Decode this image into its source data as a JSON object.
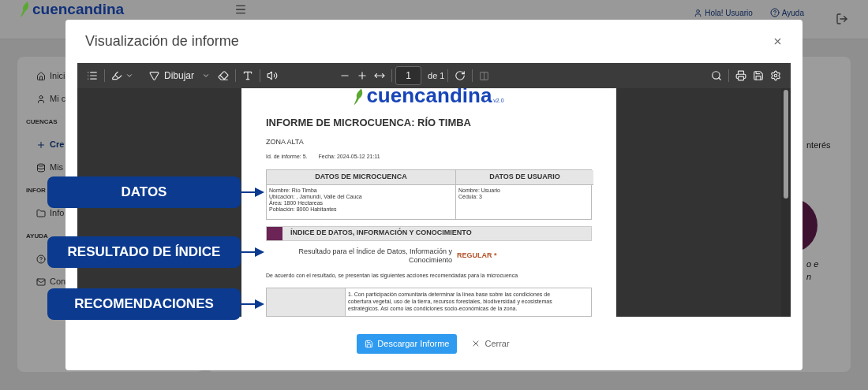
{
  "app_header": {
    "logo": "cuencandina",
    "user": "Hola! Usuario",
    "help": "Ayuda"
  },
  "sidebar": {
    "items": [
      {
        "kind": "item",
        "label": "Inici"
      },
      {
        "kind": "item",
        "label": "Mi c"
      },
      {
        "kind": "section",
        "label": "CUENCAS"
      },
      {
        "kind": "link",
        "label": "Cre"
      },
      {
        "kind": "item",
        "label": "Mis"
      },
      {
        "kind": "section",
        "label": "INFOR"
      },
      {
        "kind": "item",
        "label": "Info"
      },
      {
        "kind": "section",
        "label": "AYUDA"
      },
      {
        "kind": "item"
      },
      {
        "kind": "item",
        "label": "Con"
      }
    ]
  },
  "background_fragments": {
    "interest": "nterés",
    "line_1": "o e",
    "line_2": "n"
  },
  "modal": {
    "title": "Visualización de informe",
    "viewer": {
      "draw_label": "Dibujar",
      "page": "1",
      "page_total": "de 1",
      "two_page_disabled": true
    },
    "document": {
      "logo": "cuencandina",
      "version": "v2.0",
      "title": "INFORME DE MICROCUENCA: RÍO TIMBA",
      "zone": "ZONA ALTA",
      "report_id": "Id. de informe: 5.",
      "date": "Fecha: 2024-05-12  21:11",
      "table": {
        "columns": [
          "DATOS DE MICROCUENCA",
          "DATOS DE USUARIO"
        ],
        "cells": [
          [
            "Nombre: Río Timba",
            "Ubicación: , Jamundí, Valle del Cauca",
            "Área: 1800 Hectareas",
            "Población: 8000 Habitantes"
          ],
          [
            "Nombre: Usuario",
            "Cédula: 3"
          ]
        ]
      },
      "index_section": {
        "title": "ÍNDICE DE DATOS, INFORMACIÓN Y CONOCIMIENTO",
        "color": "#6b2455",
        "result_label_1": "Resultado para el Índice de Datos, Información y",
        "result_label_2": "Conocimiento",
        "result": "REGULAR *"
      },
      "intro": "De acuerdo con el resultado, se presentan las siguientes acciones recomendadas para la microcuenca",
      "recommendation_lines": [
        "1. Con participación comunitaria determinar la línea base sobre las condiciones de",
        "cobertura vegetal, uso de la tierra, recursos forestales, biodiversidad y ecosistemas",
        "estratégicos. Así como las condiciones socio-económicas de la zona."
      ]
    },
    "buttons": {
      "download": "Descargar Informe",
      "close": "Cerrar"
    }
  },
  "callouts": [
    "DATOS",
    "RESULTADO DE ÍNDICE",
    "RECOMENDACIONES"
  ]
}
